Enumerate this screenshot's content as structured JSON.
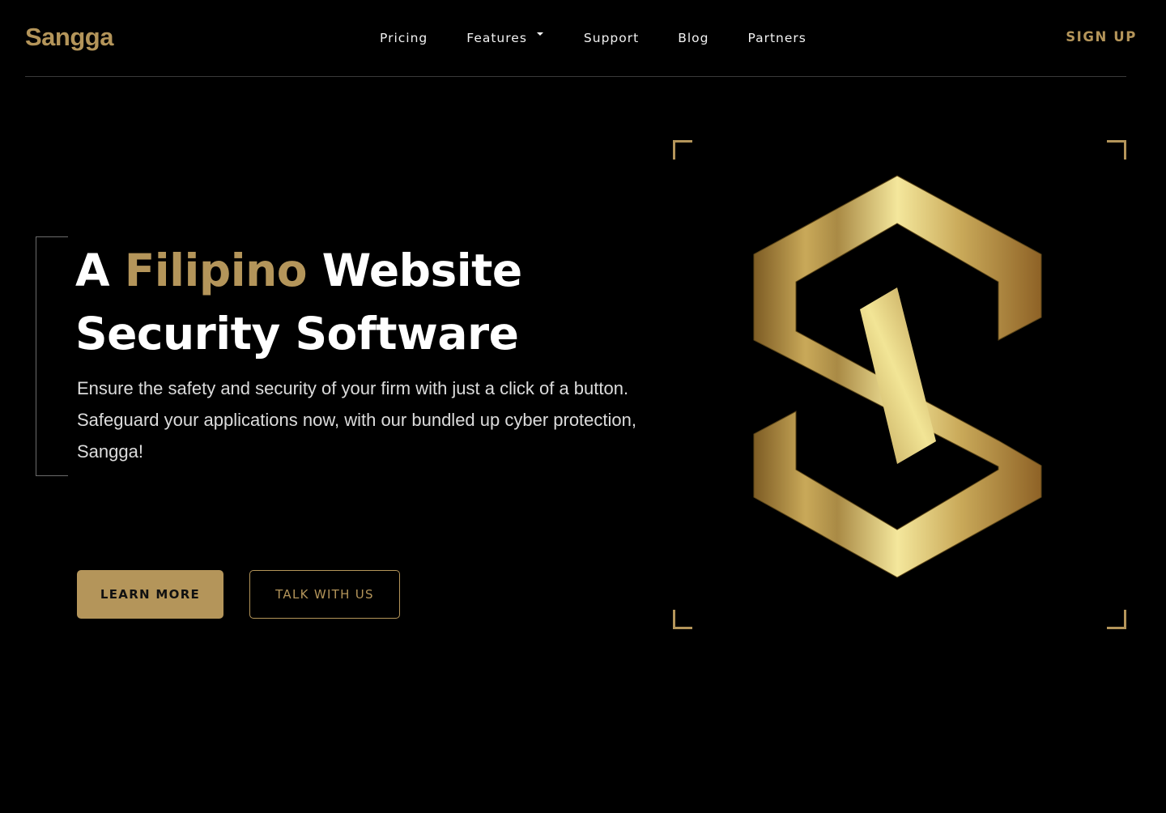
{
  "brand": {
    "name": "Sangga",
    "accent_color": "#b4955a"
  },
  "nav": {
    "items": [
      {
        "label": "Pricing",
        "has_dropdown": false
      },
      {
        "label": "Features",
        "has_dropdown": true
      },
      {
        "label": "Support",
        "has_dropdown": false
      },
      {
        "label": "Blog",
        "has_dropdown": false
      },
      {
        "label": "Partners",
        "has_dropdown": false
      }
    ],
    "signup_label": "SIGN UP"
  },
  "hero": {
    "title_prefix": "A ",
    "title_accent": "Filipino",
    "title_line1_suffix": " Website",
    "title_line2": "Security Software",
    "description": "Ensure the safety and security of your firm with just a click of a button. Safeguard your applications now, with our bundled up cyber protection, Sangga!",
    "primary_button": "LEARN MORE",
    "secondary_button": "TALK WITH US"
  },
  "icons": {
    "features_dropdown": "chevron-down-icon",
    "hero_logo": "sangga-s-logo"
  },
  "colors": {
    "background": "#000000",
    "gold": "#b4955a",
    "text": "#ffffff"
  }
}
